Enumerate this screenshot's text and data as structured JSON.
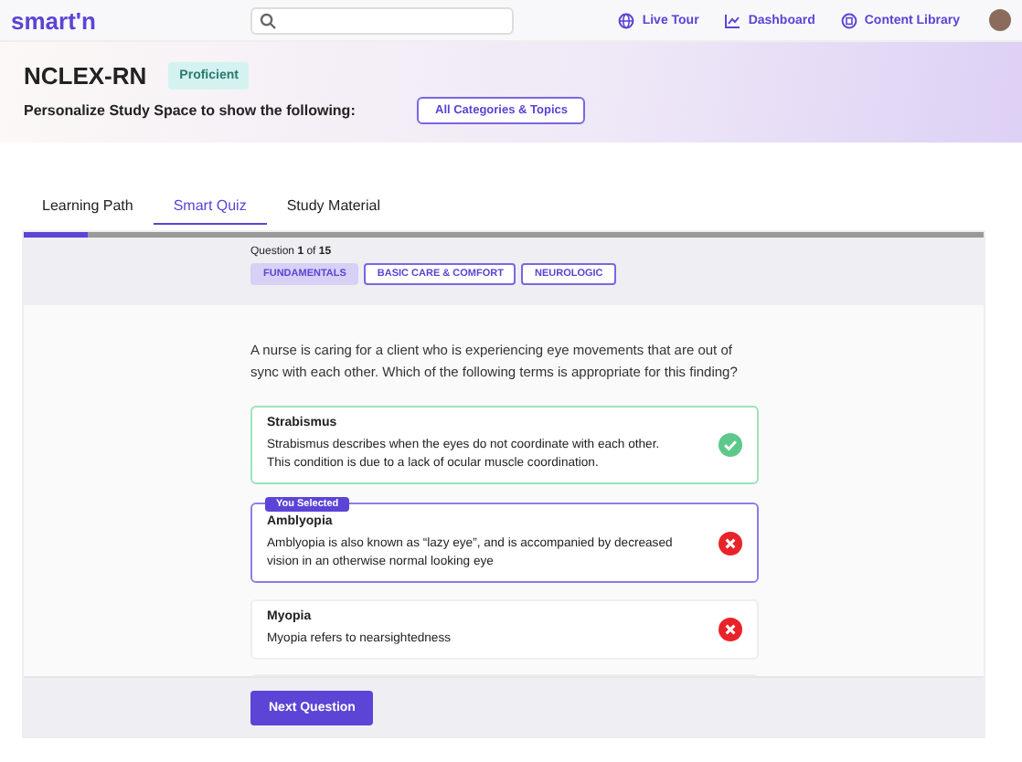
{
  "header": {
    "logo": "smart'n",
    "nav": [
      {
        "label": "Live Tour",
        "kind": "globe"
      },
      {
        "label": "Dashboard",
        "kind": "chart"
      },
      {
        "label": "Content Library",
        "kind": "library"
      }
    ]
  },
  "hero": {
    "title": "NCLEX-RN",
    "badge": "Proficient",
    "prompt": "Personalize Study Space to show the following:",
    "filter_button": "All Categories & Topics"
  },
  "tabs": [
    {
      "label": "Learning Path",
      "selected": false
    },
    {
      "label": "Smart Quiz",
      "selected": true
    },
    {
      "label": "Study Material",
      "selected": false
    }
  ],
  "quiz": {
    "progress": {
      "level": 0.067
    },
    "counter": "Question **1** of **15**",
    "tags": [
      {
        "label": "FUNDAMENTALS",
        "selected": true
      },
      {
        "label": "BASIC CARE & COMFORT",
        "selected": false
      },
      {
        "label": "NEUROLOGIC",
        "selected": false
      }
    ],
    "question": "A nurse is caring for a client who is experiencing eye movements that are out of sync with each other. Which of the following terms is appropriate for this finding?",
    "options": [
      {
        "title": "Strabismus",
        "text": "Strabismus describes when the eyes do not coordinate with each other. This condition is due to a lack of ocular muscle coordination.",
        "kind": "correct",
        "selected": false
      },
      {
        "title": "Amblyopia",
        "text": "Amblyopia is also known as “lazy eye”, and is accompanied by decreased vision in an otherwise normal looking eye",
        "kind": "incorrect",
        "selected": true,
        "selected_label": "You Selected"
      },
      {
        "title": "Myopia",
        "text": "Myopia refers to nearsightedness",
        "kind": "incorrect",
        "selected": false
      },
      {
        "kind": "hidden"
      }
    ],
    "next_button": "Next Question"
  }
}
